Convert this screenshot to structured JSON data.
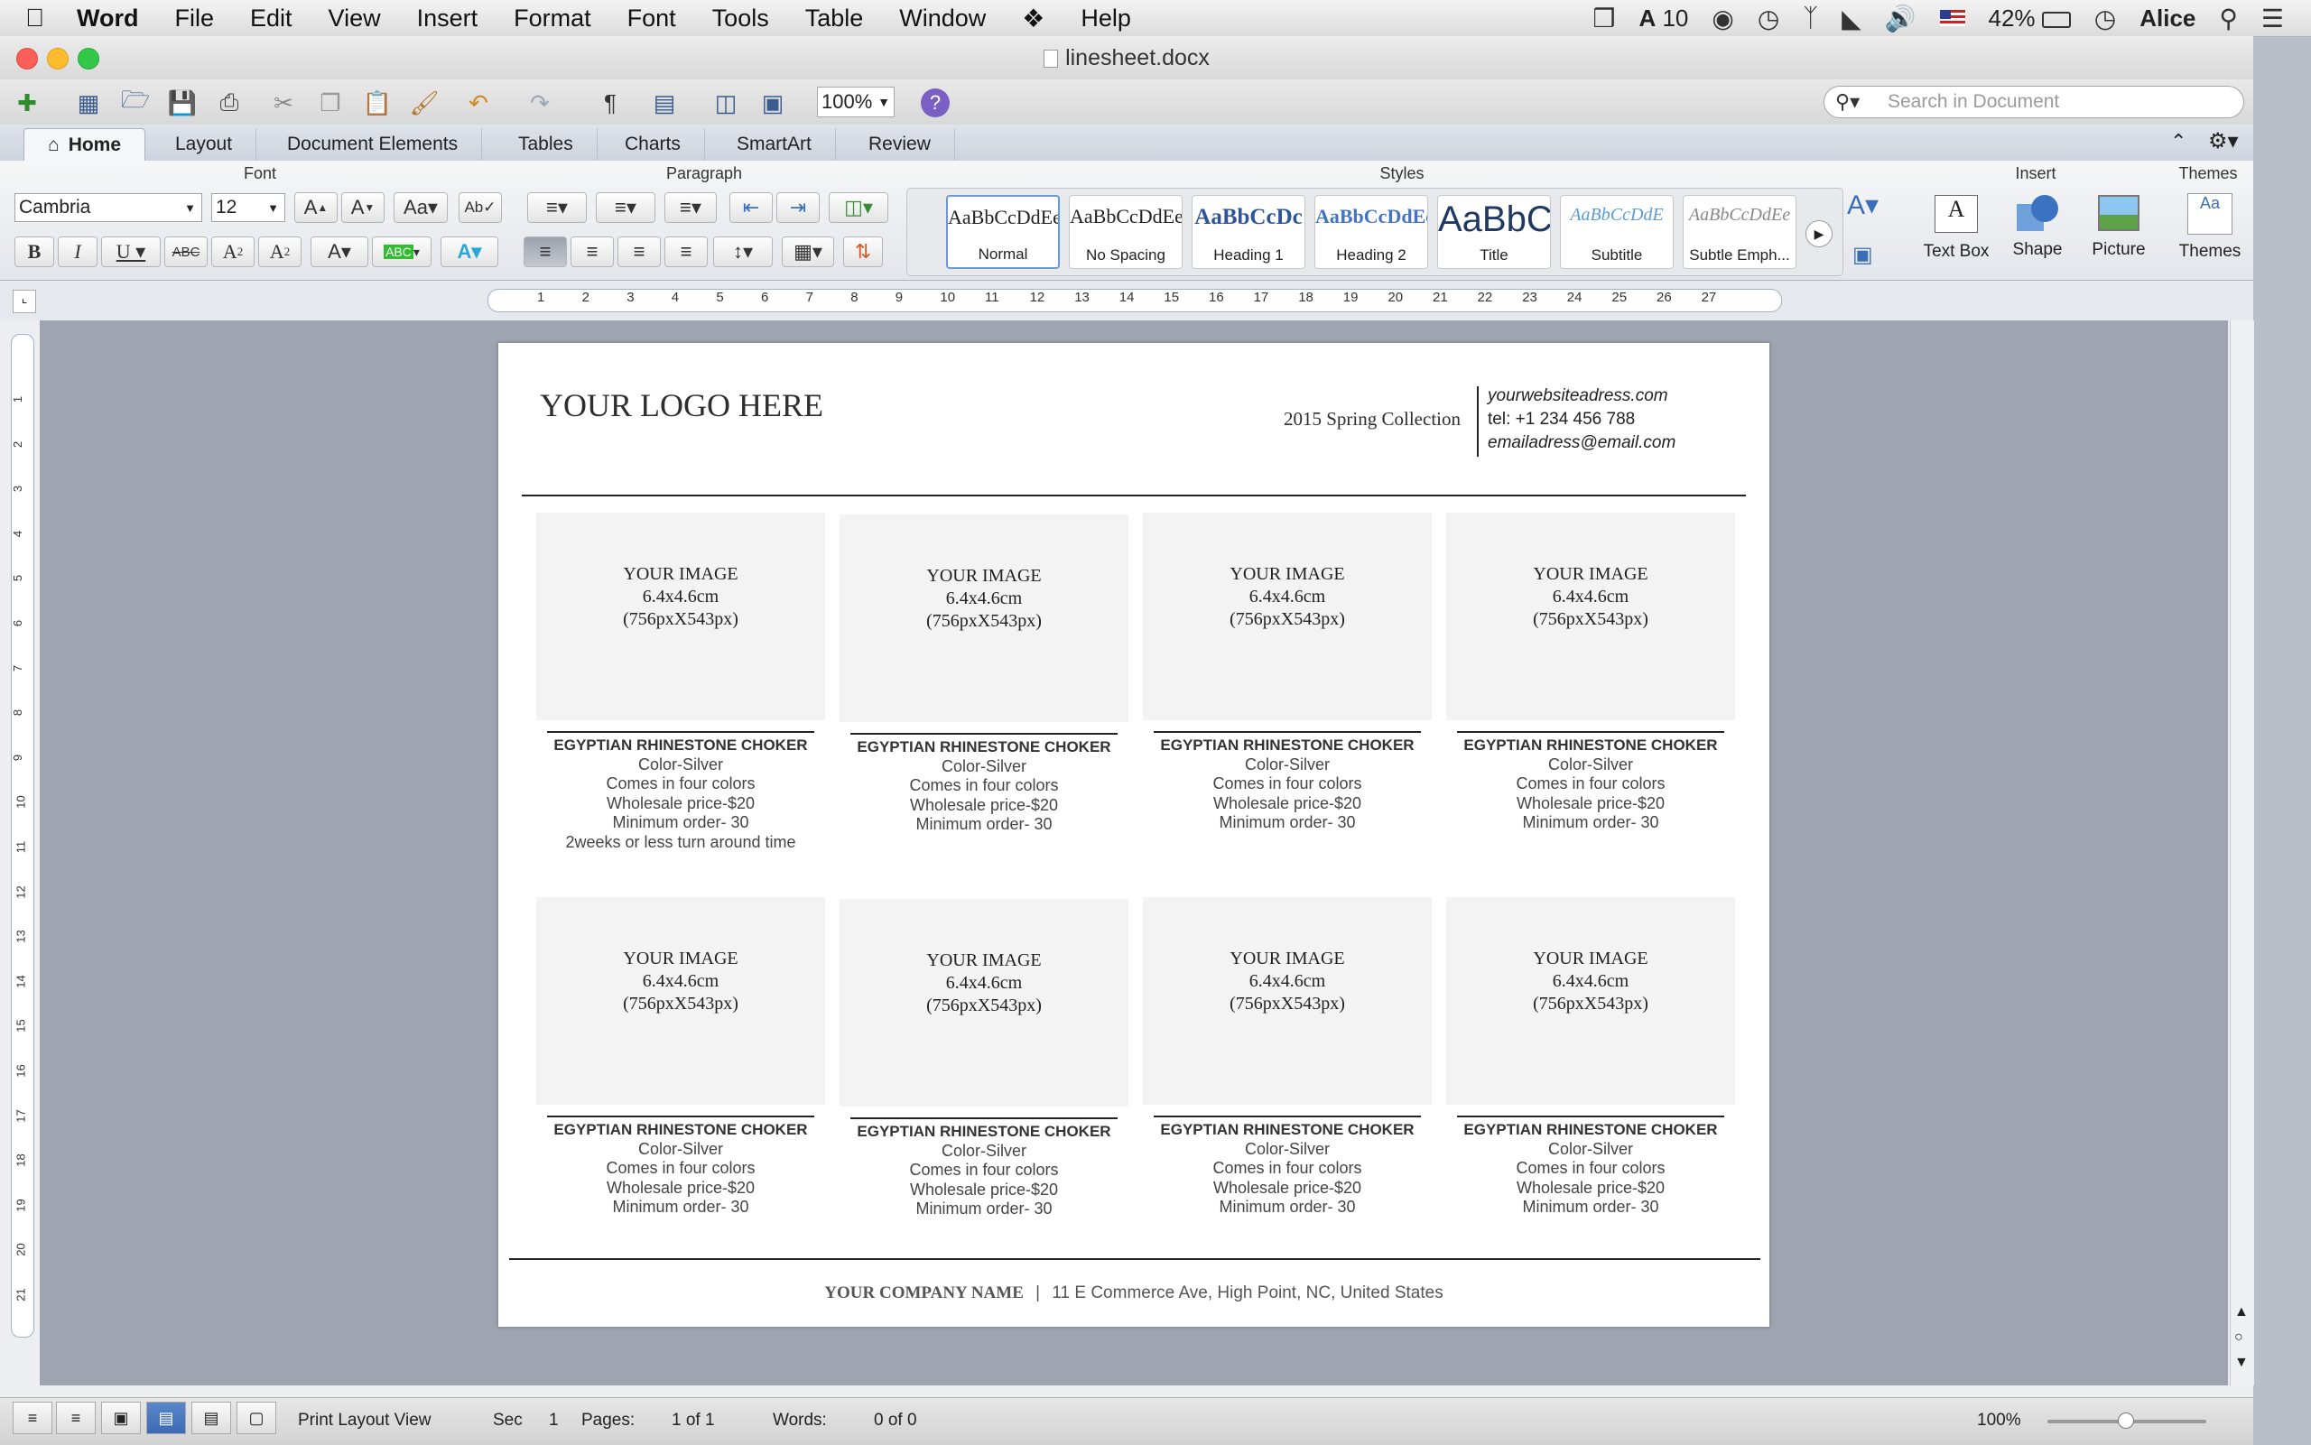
{
  "menubar": {
    "app": "Word",
    "items": [
      "File",
      "Edit",
      "View",
      "Insert",
      "Format",
      "Font",
      "Tools",
      "Table",
      "Window",
      "Help"
    ],
    "adobe_count": "10",
    "battery": "42%",
    "user": "Alice"
  },
  "window": {
    "title": "linesheet.docx"
  },
  "toolbar": {
    "zoom": "100%",
    "search_placeholder": "Search in Document"
  },
  "ribbon_tabs": [
    "Home",
    "Layout",
    "Document Elements",
    "Tables",
    "Charts",
    "SmartArt",
    "Review"
  ],
  "ribbon": {
    "font_group": "Font",
    "paragraph_group": "Paragraph",
    "styles_group": "Styles",
    "insert_group": "Insert",
    "themes_group": "Themes",
    "font_name": "Cambria",
    "font_size": "12",
    "styles": [
      {
        "preview": "AaBbCcDdEe",
        "name": "Normal"
      },
      {
        "preview": "AaBbCcDdEe",
        "name": "No Spacing"
      },
      {
        "preview": "AaBbCcDc",
        "name": "Heading 1"
      },
      {
        "preview": "AaBbCcDdEe",
        "name": "Heading 2"
      },
      {
        "preview": "AaBbC",
        "name": "Title"
      },
      {
        "preview": "AaBbCcDdE",
        "name": "Subtitle"
      },
      {
        "preview": "AaBbCcDdEe",
        "name": "Subtle Emph..."
      }
    ],
    "insert_items": [
      "Text Box",
      "Shape",
      "Picture"
    ],
    "themes_label": "Themes"
  },
  "document": {
    "logo": "YOUR LOGO HERE",
    "collection": "2015 Spring Collection",
    "website": "yourwebsiteadress.com",
    "tel": "tel: +1 234 456 788",
    "email": "emailadress@email.com",
    "image_placeholder": {
      "line1": "YOUR IMAGE",
      "line2": "6.4x4.6cm",
      "line3": "(756pxX543px)"
    },
    "products": [
      {
        "name": "EGYPTIAN RHINESTONE CHOKER",
        "lines": [
          "Color-Silver",
          "Comes in four colors",
          "Wholesale price-$20",
          "Minimum order- 30",
          "2weeks or less turn around time"
        ]
      },
      {
        "name": "EGYPTIAN RHINESTONE CHOKER",
        "lines": [
          "Color-Silver",
          "Comes in four colors",
          "Wholesale price-$20",
          "Minimum order- 30"
        ]
      },
      {
        "name": "EGYPTIAN RHINESTONE CHOKER",
        "lines": [
          "Color-Silver",
          "Comes in four colors",
          "Wholesale price-$20",
          "Minimum order- 30"
        ]
      },
      {
        "name": "EGYPTIAN RHINESTONE CHOKER",
        "lines": [
          "Color-Silver",
          "Comes in four colors",
          "Wholesale price-$20",
          "Minimum order- 30"
        ]
      },
      {
        "name": "EGYPTIAN RHINESTONE CHOKER",
        "lines": [
          "Color-Silver",
          "Comes in four colors",
          "Wholesale price-$20",
          "Minimum order- 30"
        ]
      },
      {
        "name": "EGYPTIAN RHINESTONE CHOKER",
        "lines": [
          "Color-Silver",
          "Comes in four colors",
          "Wholesale price-$20",
          "Minimum order- 30"
        ]
      },
      {
        "name": "EGYPTIAN RHINESTONE CHOKER",
        "lines": [
          "Color-Silver",
          "Comes in four colors",
          "Wholesale price-$20",
          "Minimum order- 30"
        ]
      },
      {
        "name": "EGYPTIAN RHINESTONE CHOKER",
        "lines": [
          "Color-Silver",
          "Comes in four colors",
          "Wholesale price-$20",
          "Minimum order- 30"
        ]
      }
    ],
    "footer_company": "YOUR COMPANY NAME",
    "footer_separator": "|",
    "footer_address": "11 E Commerce Ave, High Point, NC, United States"
  },
  "statusbar": {
    "view": "Print Layout View",
    "sec_label": "Sec",
    "sec_value": "1",
    "pages_label": "Pages:",
    "pages_value": "1 of 1",
    "words_label": "Words:",
    "words_value": "0 of 0",
    "zoom": "100%"
  },
  "ruler_numbers": [
    "1",
    "2",
    "3",
    "4",
    "5",
    "6",
    "7",
    "8",
    "9",
    "10",
    "11",
    "12",
    "13",
    "14",
    "15",
    "16",
    "17",
    "18",
    "19",
    "20",
    "21",
    "22",
    "23",
    "24",
    "25",
    "26",
    "27"
  ],
  "vruler_numbers": [
    "1",
    "2",
    "3",
    "4",
    "5",
    "6",
    "7",
    "8",
    "9",
    "10",
    "11",
    "12",
    "13",
    "14",
    "15",
    "16",
    "17",
    "18",
    "19",
    "20",
    "21"
  ]
}
